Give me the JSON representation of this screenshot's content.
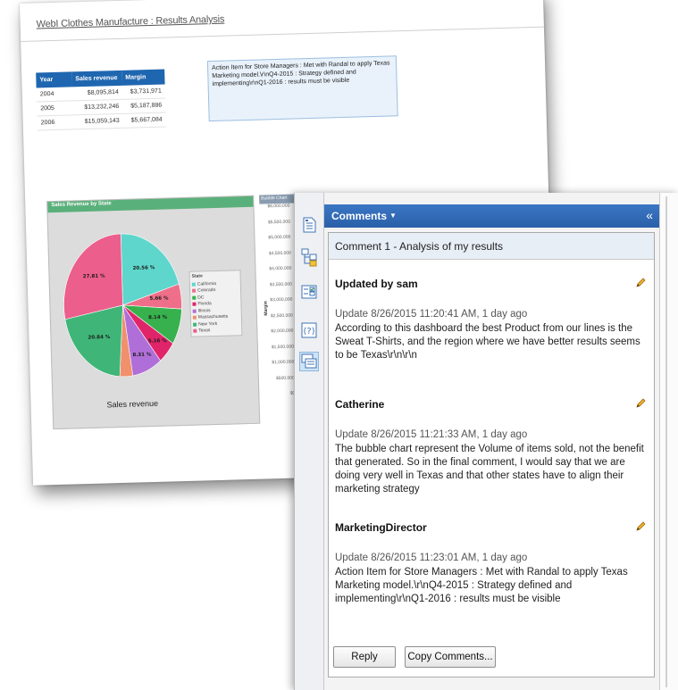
{
  "report": {
    "title": "WebI Clothes Manufacture : Results Analysis",
    "table": {
      "headers": [
        "Year",
        "Sales revenue",
        "Margin"
      ],
      "rows": [
        [
          "2004",
          "$8,095,814",
          "$3,731,971"
        ],
        [
          "2005",
          "$13,232,246",
          "$5,187,886"
        ],
        [
          "2006",
          "$15,059,143",
          "$5,667,084"
        ]
      ]
    },
    "action_note": "Action Item for Store Managers : Met with Randal to apply Texas Marketing model.\\r\\nQ4-2015 : Strategy defined and implementing\\r\\nQ1-2016 : results must be visible",
    "pie": {
      "title": "Sales Revenue by State",
      "caption": "Sales revenue",
      "legend_title": "State",
      "legend": [
        "California",
        "Colorado",
        "DC",
        "Florida",
        "Illinois",
        "Massachusetts",
        "New York",
        "Texas"
      ],
      "label_pct": [
        "20.56 %",
        "5.66 %",
        "8.14 %",
        "5.16 %",
        "8.31 %",
        "20.84 %",
        "27.81 %"
      ]
    },
    "bubble": {
      "title": "Bubble Chart",
      "axis_label": "Margin",
      "ticks": [
        "$6,000,000",
        "$5,500,000",
        "$5,000,000",
        "$4,500,000",
        "$4,000,000",
        "$3,500,000",
        "$3,000,000",
        "$2,500,000",
        "$2,000,000",
        "$1,500,000",
        "$1,000,000",
        "$500,000",
        "$0"
      ]
    }
  },
  "chart_data": {
    "type": "pie",
    "title": "Sales Revenue by State",
    "caption": "Sales revenue",
    "legend_title": "State",
    "slices": [
      {
        "name": "California",
        "value": 20.56,
        "color": "#5ed6cc"
      },
      {
        "name": "Colorado",
        "value": 5.66,
        "color": "#ef6f8a"
      },
      {
        "name": "DC",
        "value": 8.14,
        "color": "#37b14d"
      },
      {
        "name": "Florida",
        "value": 5.16,
        "color": "#e0246a"
      },
      {
        "name": "Illinois",
        "value": 8.31,
        "color": "#b06fd8"
      },
      {
        "name": "Massachusetts",
        "value": 3.52,
        "color": "#f0906c"
      },
      {
        "name": "New York",
        "value": 20.84,
        "color": "#3fb678"
      },
      {
        "name": "Texas",
        "value": 27.81,
        "color": "#ec5e8c"
      }
    ]
  },
  "comments_panel": {
    "header": "Comments",
    "thread_title": "Comment 1 - Analysis of my results",
    "comments": [
      {
        "author": "Updated by sam",
        "meta": "Update 8/26/2015 11:20:41 AM, 1 day ago",
        "body": "According to this dashboard the best Product from our lines is the Sweat T-Shirts, and the region where we have better results seems to be Texas\\r\\n\\r\\n"
      },
      {
        "author": "Catherine",
        "meta": "Update 8/26/2015 11:21:33 AM, 1 day ago",
        "body": "The bubble chart represent the Volume of items sold, not the benefit that generated. So in the final comment, I would say that we are doing very well in Texas and that other states have to align their marketing strategy"
      },
      {
        "author": "MarketingDirector",
        "meta": "Update 8/26/2015 11:23:01 AM, 1 day ago",
        "body": "Action Item for Store Managers : Met with Randal to apply Texas Marketing model.\\r\\nQ4-2015 : Strategy defined and implementing\\r\\nQ1-2016 : results must be visible"
      }
    ],
    "reply_label": "Reply",
    "copy_label": "Copy Comments..."
  },
  "icons": [
    "document-properties-icon",
    "structure-tree-icon",
    "input-controls-icon",
    "help-icon",
    "comments-icon",
    "pencil-edit-icon",
    "chevron-down-icon",
    "collapse-double-chevron-icon"
  ]
}
